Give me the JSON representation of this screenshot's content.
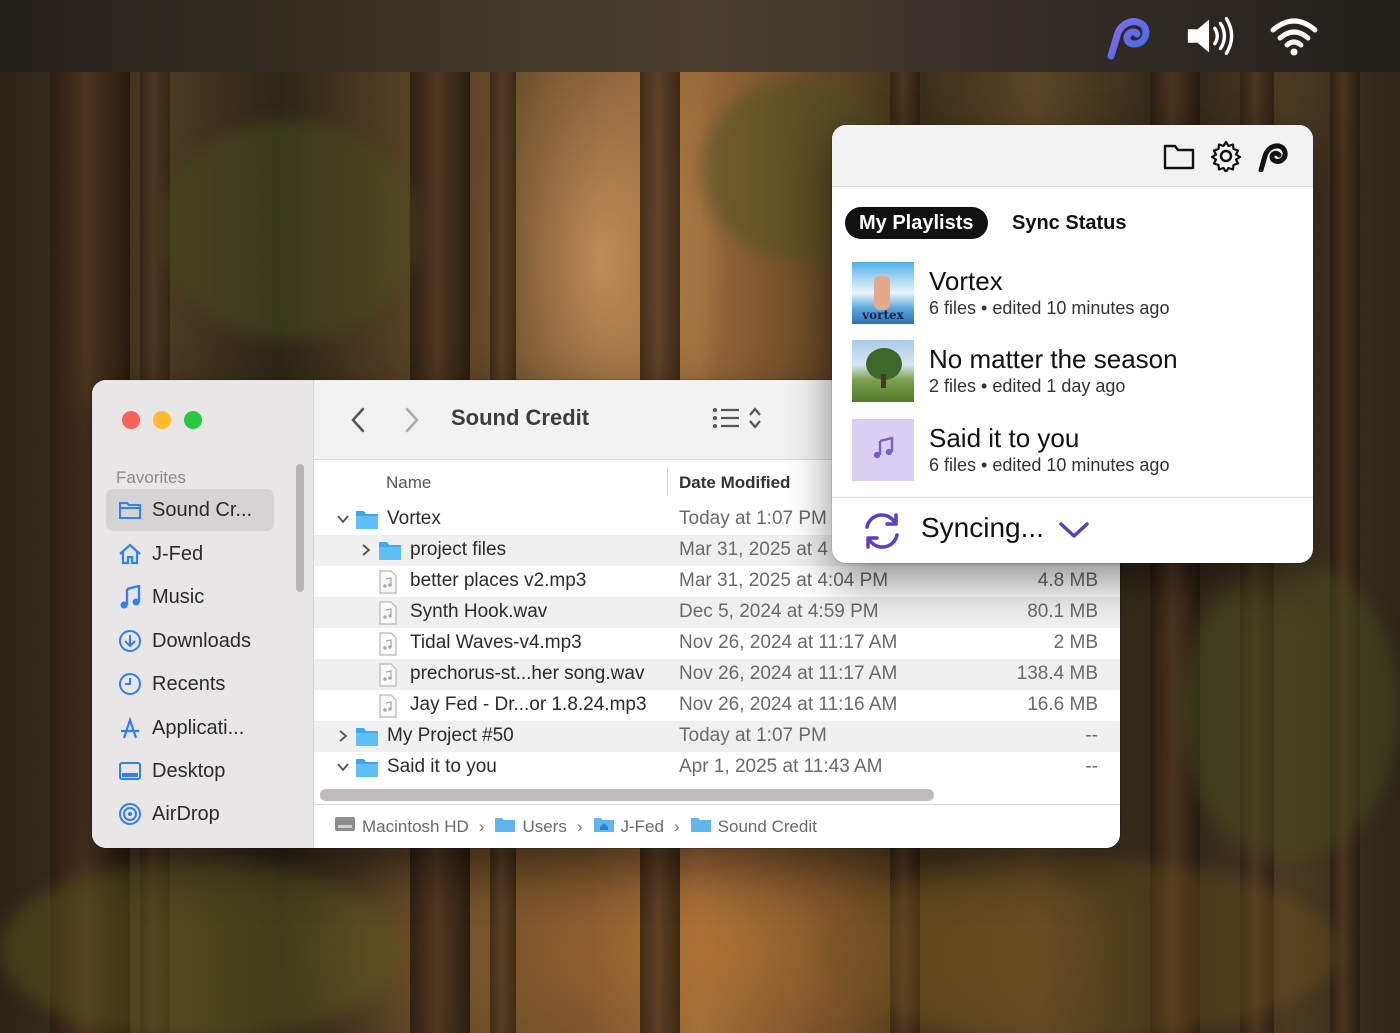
{
  "menubar": {
    "icons": [
      "app-logo-icon",
      "volume-icon",
      "wifi-icon"
    ]
  },
  "finder": {
    "title": "Sound Credit",
    "sidebar": {
      "header": "Favorites",
      "items": [
        {
          "label": "Sound Cr...",
          "icon": "folder-icon",
          "active": true
        },
        {
          "label": "J-Fed",
          "icon": "home-icon"
        },
        {
          "label": "Music",
          "icon": "music-note-icon"
        },
        {
          "label": "Downloads",
          "icon": "download-icon"
        },
        {
          "label": "Recents",
          "icon": "clock-icon"
        },
        {
          "label": "Applicati...",
          "icon": "applications-icon"
        },
        {
          "label": "Desktop",
          "icon": "desktop-icon"
        },
        {
          "label": "AirDrop",
          "icon": "airdrop-icon"
        }
      ]
    },
    "columns": {
      "name": "Name",
      "date": "Date Modified"
    },
    "rows": [
      {
        "name": "Vortex",
        "date": "Today at 1:07 PM",
        "size": "",
        "type": "folder",
        "disclosure": "open",
        "depth": 0
      },
      {
        "name": "project files",
        "date": "Mar 31, 2025 at 4",
        "size": "",
        "type": "folder",
        "disclosure": "closed",
        "depth": 1
      },
      {
        "name": "better places v2.mp3",
        "date": "Mar 31, 2025 at 4:04 PM",
        "size": "4.8 MB",
        "type": "audio",
        "disclosure": "none",
        "depth": 1
      },
      {
        "name": "Synth Hook.wav",
        "date": "Dec 5, 2024 at 4:59 PM",
        "size": "80.1 MB",
        "type": "audio",
        "disclosure": "none",
        "depth": 1
      },
      {
        "name": "Tidal Waves-v4.mp3",
        "date": "Nov 26, 2024 at 11:17 AM",
        "size": "2 MB",
        "type": "audio",
        "disclosure": "none",
        "depth": 1
      },
      {
        "name": "prechorus-st...her song.wav",
        "date": "Nov 26, 2024 at 11:17 AM",
        "size": "138.4 MB",
        "type": "audio",
        "disclosure": "none",
        "depth": 1
      },
      {
        "name": "Jay Fed - Dr...or 1.8.24.mp3",
        "date": "Nov 26, 2024 at 11:16 AM",
        "size": "16.6 MB",
        "type": "audio",
        "disclosure": "none",
        "depth": 1
      },
      {
        "name": "My Project #50",
        "date": "Today at 1:07 PM",
        "size": "--",
        "type": "folder",
        "disclosure": "closed",
        "depth": 0
      },
      {
        "name": "Said it to you",
        "date": "Apr 1, 2025 at 11:43 AM",
        "size": "--",
        "type": "folder",
        "disclosure": "open",
        "depth": 0
      }
    ],
    "path": [
      "Macintosh HD",
      "Users",
      "J-Fed",
      "Sound Credit"
    ]
  },
  "popover": {
    "header_icons": [
      "folder-icon",
      "gear-icon",
      "app-logo-icon"
    ],
    "tabs": [
      {
        "label": "My Playlists",
        "active": true
      },
      {
        "label": "Sync Status",
        "active": false
      }
    ],
    "playlists": [
      {
        "title": "Vortex",
        "meta": "6 files • edited 10 minutes ago",
        "thumb_text": "vortex"
      },
      {
        "title": "No matter the season",
        "meta": "2 files • edited 1 day ago",
        "thumb_text": ""
      },
      {
        "title": "Said it to you",
        "meta": "6 files • edited 10 minutes ago",
        "thumb_text": ""
      }
    ],
    "status": "Syncing...",
    "accent": "#5a3ec8"
  }
}
